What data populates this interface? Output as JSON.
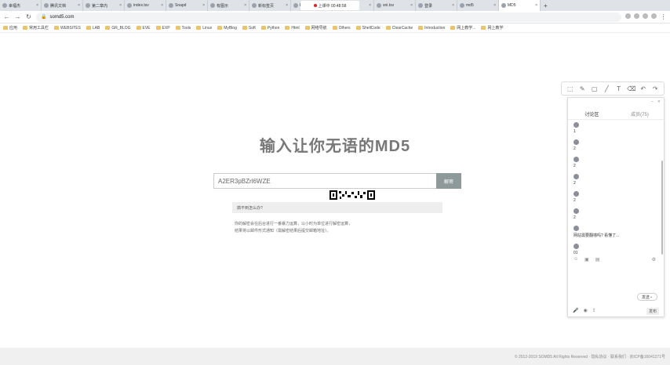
{
  "browser": {
    "tabs": [
      {
        "label": "幸福杰",
        "active": false
      },
      {
        "label": "腾讯文档",
        "active": false
      },
      {
        "label": "第二章内",
        "active": false
      },
      {
        "label": "index.tsv",
        "active": false
      },
      {
        "label": "Snapd",
        "active": false
      },
      {
        "label": "有图示",
        "active": false
      },
      {
        "label": "新标签页",
        "active": false
      },
      {
        "label": "Linux",
        "active": false
      },
      {
        "label": "实验室",
        "active": false
      },
      {
        "label": "sni.tsv",
        "active": false
      },
      {
        "label": "登录",
        "active": false
      },
      {
        "label": "md5",
        "active": false
      },
      {
        "label": "MD5",
        "active": true
      }
    ],
    "recording": "上课中 00:48:58",
    "url": "somd5.com",
    "bookmarks": [
      "应用",
      "常用工具栏",
      "WEBSITES",
      "LAB",
      "GR_BLOG",
      "EVE",
      "EXP",
      "Tools",
      "Linux",
      "MyBlog",
      "Soft",
      "Python",
      "Html",
      "网络导航",
      "Others",
      "ShellCode",
      "ClearCache",
      "Introduction",
      "网上教学...",
      "网上教学"
    ]
  },
  "main": {
    "title": "输入让你无语的MD5",
    "hash_value": "A2ER3pBZrl6WZE",
    "decrypt_label": "解密",
    "hint": "搞不到怎么办?",
    "description_line1": "你的解密会在后台进行一番暴力运算，以小时为单位进行解密运算，",
    "description_line2": "结果将以邮件形式通知（需解密结果后提交邮箱地址）。",
    "footer": "© 2012-2019 SOMD5 All Rights Reserved  ·  隐私协议  ·  联系我们  ·  京ICP备16041271号"
  },
  "annotation_panel": {
    "tabs": [
      "讨论区",
      "成员(75)"
    ],
    "comments": [
      {
        "name": "",
        "text": "1"
      },
      {
        "name": "",
        "text": "2"
      },
      {
        "name": "",
        "text": "2"
      },
      {
        "name": "",
        "text": "2"
      },
      {
        "name": "",
        "text": "2"
      },
      {
        "name": "",
        "text": "2"
      },
      {
        "name": "",
        "text": "网站需要翻墙吗? 看懂了..."
      },
      {
        "name": "",
        "text": "01"
      }
    ],
    "send_label": "发送",
    "post_label": "发布"
  }
}
